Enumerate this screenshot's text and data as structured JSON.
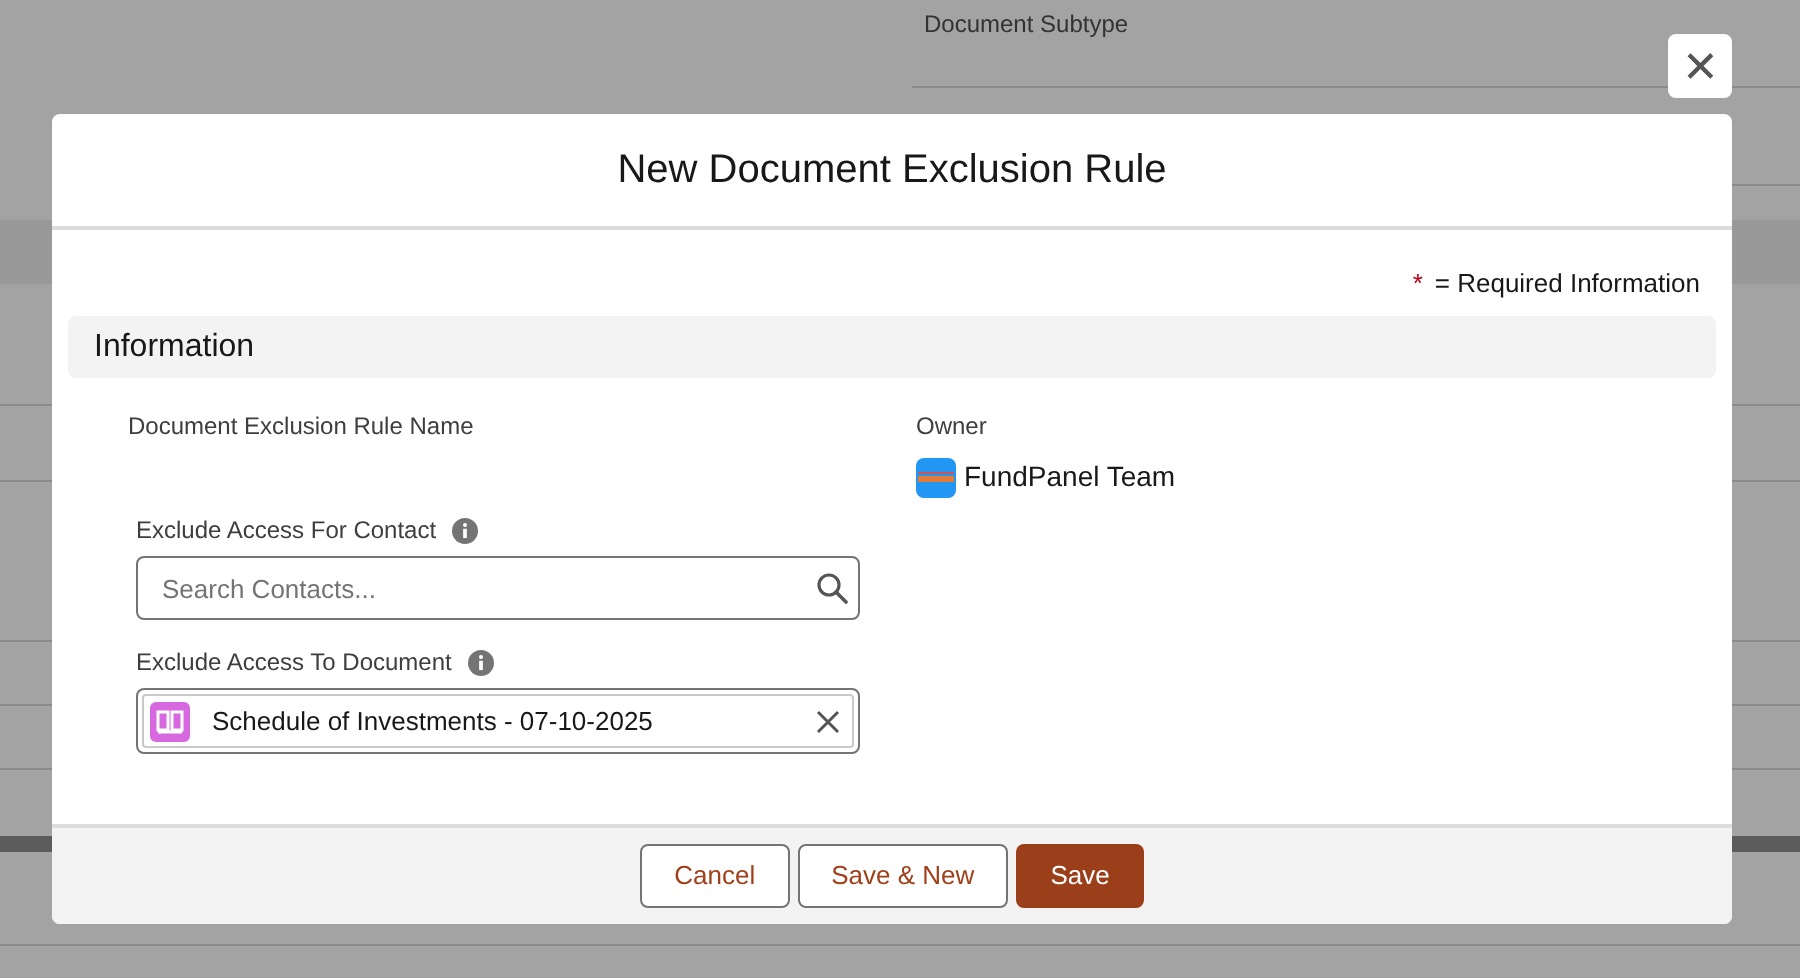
{
  "background": {
    "field_label": "Document Subtype"
  },
  "modal": {
    "title": "New Document Exclusion Rule",
    "close_glyph": "✕",
    "required_note": {
      "mark": "*",
      "text": "= Required Information"
    },
    "section": "Information",
    "fields": [
      {
        "kind": "name",
        "label": "Document Exclusion Rule Name"
      },
      {
        "kind": "owner",
        "label": "Owner",
        "value": "FundPanel Team"
      },
      {
        "kind": "search",
        "label": "Exclude Access For Contact",
        "placeholder": "Search Contacts..."
      },
      {
        "kind": "selected",
        "label": "Exclude Access To Document",
        "value": "Schedule of Investments - 07-10-2025"
      }
    ],
    "buttons": [
      {
        "label": "Cancel",
        "kind": "neutral"
      },
      {
        "label": "Save & New",
        "kind": "neutral"
      },
      {
        "label": "Save",
        "kind": "brand"
      }
    ]
  }
}
